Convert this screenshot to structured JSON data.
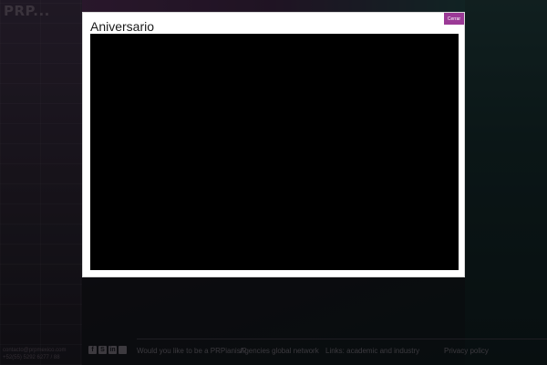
{
  "site": {
    "logo": "PRP...",
    "contact_line1": "contacto@prpmexico.com",
    "contact_line2": "+52(55) 5292 6277 / 88"
  },
  "footer": {
    "social_icons": [
      "facebook-icon",
      "skype-icon",
      "linkedin-icon",
      "mexico-flag-icon"
    ],
    "link_1": "Would you like to be a PRPianist?",
    "link_2": "Agencies global network",
    "link_3": "Links: academic and industry",
    "link_4": "Privacy policy"
  },
  "modal": {
    "title": "Aniversario",
    "close_label": "Cerrar"
  },
  "colors": {
    "accent": "#9b3a96",
    "video_bg": "#000000"
  }
}
